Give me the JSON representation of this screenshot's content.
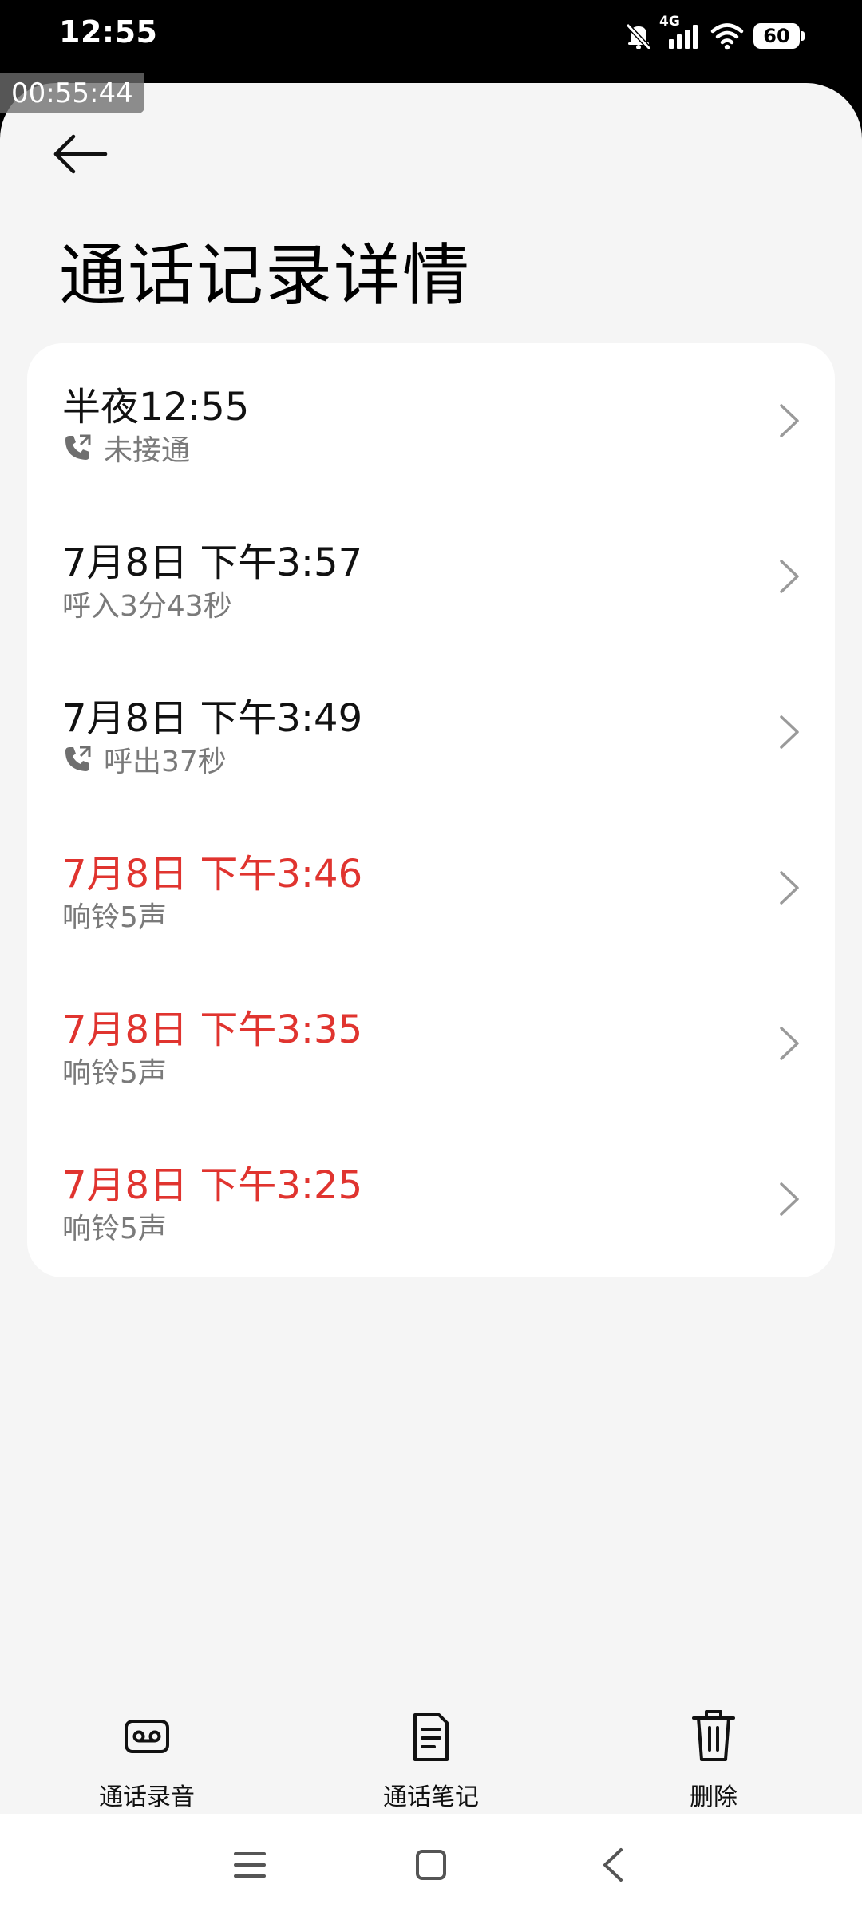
{
  "status_bar": {
    "time": "12:55",
    "network": "4G",
    "battery": "60"
  },
  "recorder_overlay": "00:55:44",
  "header": {
    "title": "通话记录详情"
  },
  "calls": [
    {
      "time": "半夜12:55",
      "detail": "未接通",
      "missed": false,
      "icon": "phone-outgoing-icon"
    },
    {
      "time": "7月8日 下午3:57",
      "detail": "呼入3分43秒",
      "missed": false,
      "icon": ""
    },
    {
      "time": "7月8日 下午3:49",
      "detail": "呼出37秒",
      "missed": false,
      "icon": "phone-outgoing-icon"
    },
    {
      "time": "7月8日 下午3:46",
      "detail": "响铃5声",
      "missed": true,
      "icon": ""
    },
    {
      "time": "7月8日 下午3:35",
      "detail": "响铃5声",
      "missed": true,
      "icon": ""
    },
    {
      "time": "7月8日 下午3:25",
      "detail": "响铃5声",
      "missed": true,
      "icon": ""
    }
  ],
  "colors": {
    "missed": "#e0342f",
    "background": "#f5f5f5",
    "card": "#ffffff"
  },
  "actions": {
    "recording_label": "通话录音",
    "notes_label": "通话笔记",
    "delete_label": "删除"
  }
}
